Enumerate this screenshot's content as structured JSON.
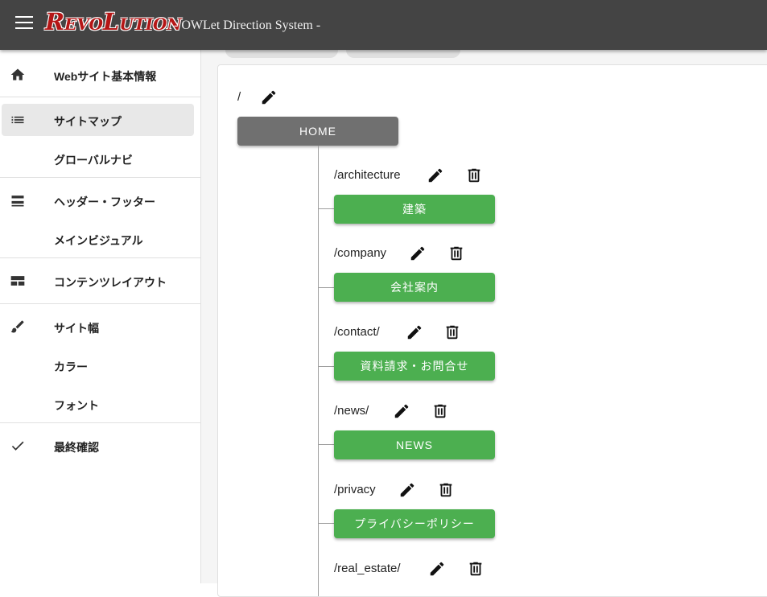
{
  "header": {
    "logo_text": "RevoLution",
    "subtitle": "- OWLet Direction System -"
  },
  "sidebar": {
    "items": [
      {
        "label": "Webサイト基本情報",
        "icon": "home-icon"
      },
      {
        "label": "サイトマップ",
        "icon": "list-icon",
        "active": true
      },
      {
        "label": "グローバルナビ",
        "icon": ""
      },
      {
        "label": "ヘッダー・フッター",
        "icon": "view-stream-icon"
      },
      {
        "label": "メインビジュアル",
        "icon": ""
      },
      {
        "label": "コンテンツレイアウト",
        "icon": "view-quilt-icon"
      },
      {
        "label": "サイト幅",
        "icon": "brush-icon"
      },
      {
        "label": "カラー",
        "icon": ""
      },
      {
        "label": "フォント",
        "icon": ""
      },
      {
        "label": "最終確認",
        "icon": "check-icon"
      }
    ]
  },
  "sitemap": {
    "root": {
      "path": "/",
      "label": "HOME"
    },
    "pages": [
      {
        "path": "/architecture",
        "label": "建築"
      },
      {
        "path": "/company",
        "label": "会社案内"
      },
      {
        "path": "/contact/",
        "label": "資料請求・お問合せ"
      },
      {
        "path": "/news/",
        "label": "NEWS"
      },
      {
        "path": "/privacy",
        "label": "プライバシーポリシー"
      },
      {
        "path": "/real_estate/",
        "label": ""
      }
    ]
  },
  "colors": {
    "appbar": "#444444",
    "page_button": "#4caf50",
    "home_button": "#707070",
    "logo": "#b51616"
  }
}
